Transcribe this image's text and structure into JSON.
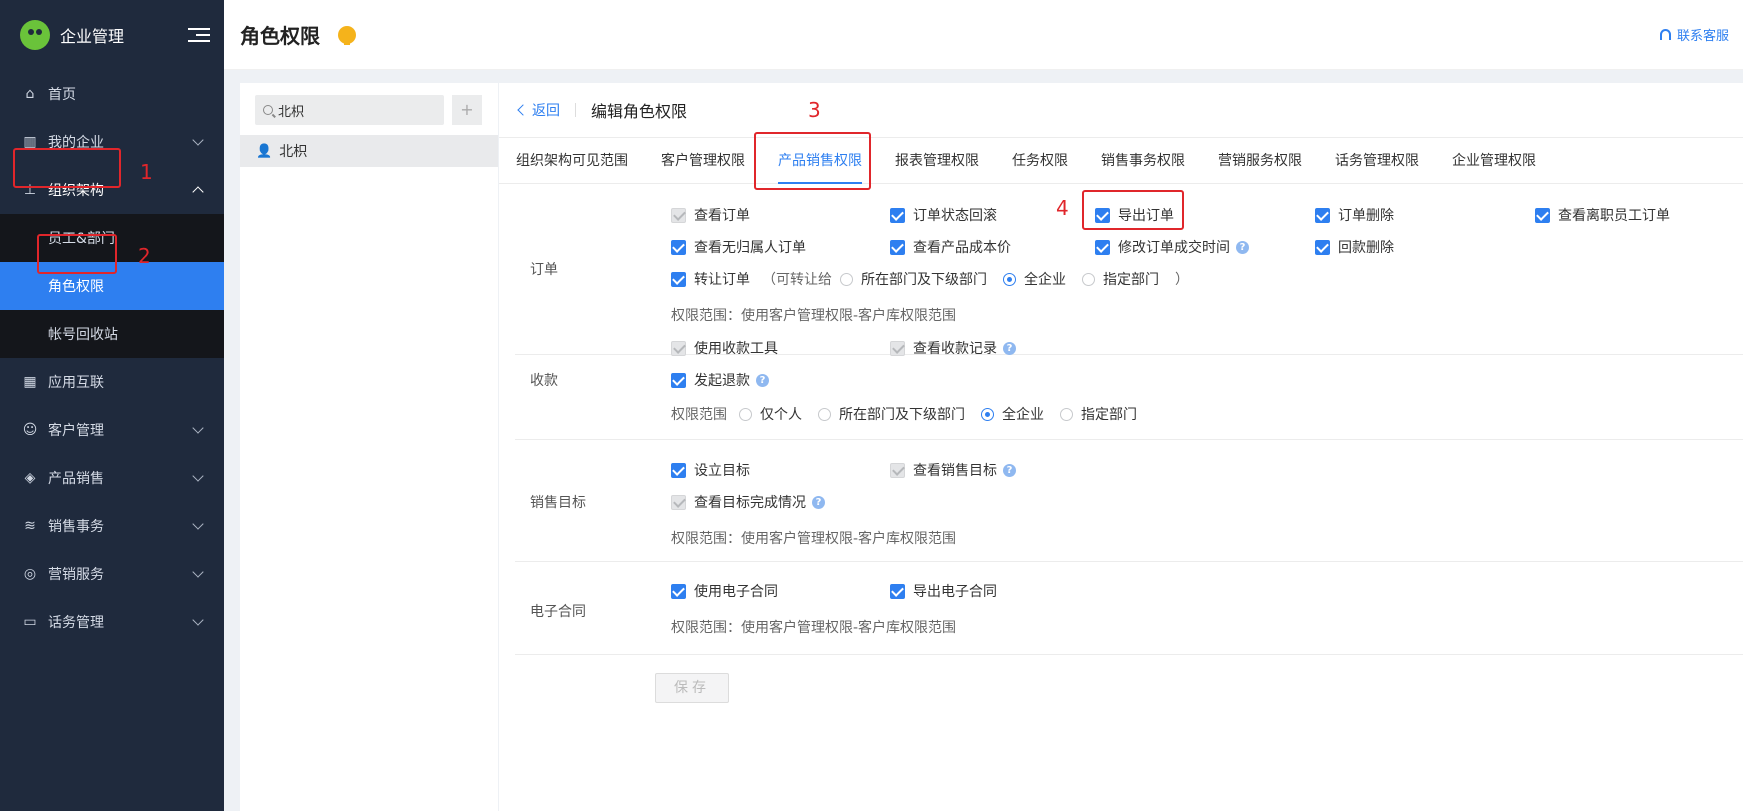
{
  "app": {
    "name": "企业管理"
  },
  "sidebar": {
    "items": [
      {
        "label": "首页",
        "icon": "home-icon"
      },
      {
        "label": "我的企业",
        "icon": "building-icon"
      },
      {
        "label": "组织架构",
        "icon": "org-chart-icon"
      },
      {
        "label": "应用互联",
        "icon": "apps-grid-icon"
      },
      {
        "label": "客户管理",
        "icon": "customer-icon"
      },
      {
        "label": "产品销售",
        "icon": "box-icon"
      },
      {
        "label": "销售事务",
        "icon": "layers-icon"
      },
      {
        "label": "营销服务",
        "icon": "target-icon"
      },
      {
        "label": "话务管理",
        "icon": "phone-box-icon"
      }
    ],
    "sub_items": [
      {
        "label": "员工&部门"
      },
      {
        "label": "角色权限"
      },
      {
        "label": "帐号回收站"
      }
    ]
  },
  "annotations": [
    "1",
    "2",
    "3",
    "4"
  ],
  "header": {
    "title": "角色权限",
    "support": "联系客服"
  },
  "left_panel": {
    "search_value": "北枳",
    "add_label": "+",
    "roles": [
      "北枳"
    ]
  },
  "main": {
    "back_label": "返回",
    "title": "编辑角色权限",
    "tabs": [
      "组织架构可见范围",
      "客户管理权限",
      "产品销售权限",
      "报表管理权限",
      "任务权限",
      "销售事务权限",
      "营销服务权限",
      "话务管理权限",
      "企业管理权限"
    ],
    "active_tab": "产品销售权限",
    "sections": {
      "order": {
        "label": "订单",
        "checks": [
          "查看订单",
          "订单状态回滚",
          "导出订单",
          "订单删除",
          "查看离职员工订单",
          "查看无归属人订单",
          "查看产品成本价",
          "修改订单成交时间",
          "回款删除",
          "转让订单"
        ],
        "transfer_prefix": "（可转让给",
        "transfer_options": [
          "所在部门及下级部门",
          "全企业",
          "指定部门"
        ],
        "transfer_suffix": "）",
        "scope_note": "权限范围：使用客户管理权限-客户库权限范围"
      },
      "payment": {
        "label": "收款",
        "checks": [
          "使用收款工具",
          "查看收款记录",
          "发起退款"
        ],
        "scope_label": "权限范围",
        "scope_options": [
          "仅个人",
          "所在部门及下级部门",
          "全企业",
          "指定部门"
        ]
      },
      "target": {
        "label": "销售目标",
        "checks": [
          "设立目标",
          "查看销售目标",
          "查看目标完成情况"
        ],
        "scope_note": "权限范围：使用客户管理权限-客户库权限范围"
      },
      "contract": {
        "label": "电子合同",
        "checks": [
          "使用电子合同",
          "导出电子合同"
        ],
        "scope_note": "权限范围：使用客户管理权限-客户库权限范围"
      }
    },
    "save_label": "保存"
  },
  "colors": {
    "accent": "#2e7ff0",
    "sidebar_bg": "#1f2a3d",
    "annotation": "#e0262b"
  }
}
